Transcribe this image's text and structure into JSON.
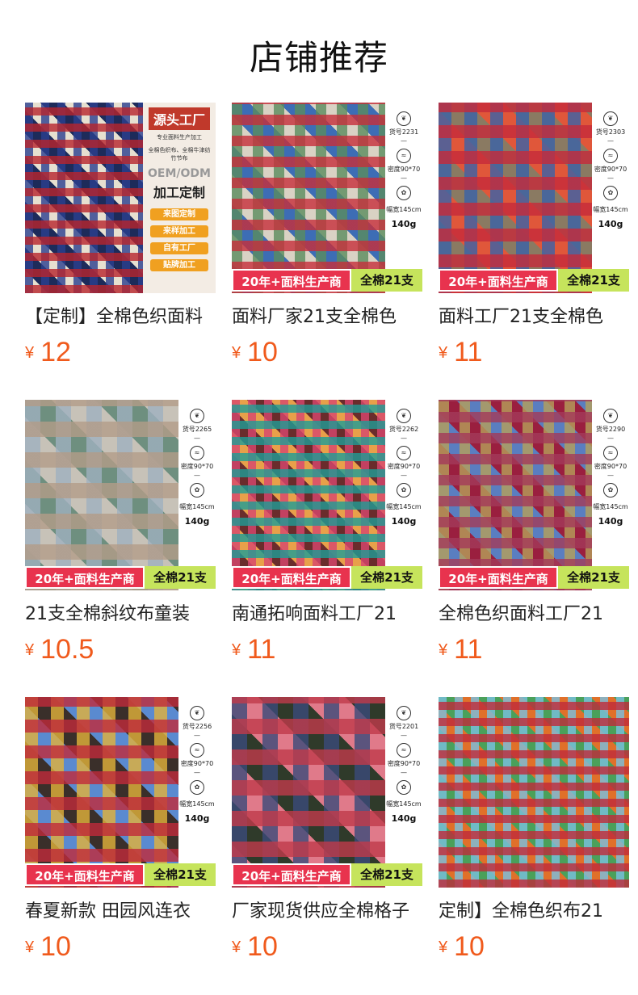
{
  "page": {
    "title": "店铺推荐"
  },
  "promo": {
    "left": "20年+面料生产商",
    "right": "全棉21支"
  },
  "spec_labels": {
    "item_prefix": "货号",
    "density": "密度90*70",
    "width": "幅宽145cm",
    "weight": "140g"
  },
  "hero": {
    "badge": "源头工厂",
    "sub": "专业面料生产加工",
    "desc": "全棉色织布、全棉牛津纺竹节布",
    "oem": "OEM/ODM",
    "proc": "加工定制",
    "pills": [
      "来图定制",
      "来样加工",
      "自有工厂",
      "贴牌加工"
    ]
  },
  "products": [
    {
      "title": "【定制】全棉色织面料",
      "currency": "¥",
      "price": "12",
      "item_no": "",
      "colors": [
        "#b8242c",
        "#2a3f8f",
        "#e6e0d0",
        "#1d2b5a"
      ]
    },
    {
      "title": "面料厂家21支全棉色",
      "currency": "¥",
      "price": "10",
      "item_no": "2231",
      "colors": [
        "#c72e3a",
        "#5a8c5e",
        "#3d6db5",
        "#d9d2c4"
      ]
    },
    {
      "title": "面料工厂21支全棉色",
      "currency": "¥",
      "price": "11",
      "item_no": "2303",
      "colors": [
        "#c62a3a",
        "#3a62a8",
        "#e0573a",
        "#8a7a62"
      ]
    },
    {
      "title": "21支全棉斜纹布童装",
      "currency": "¥",
      "price": "10.5",
      "item_no": "2265",
      "colors": [
        "#b39c88",
        "#9fb0bf",
        "#6e8f7f",
        "#c7c2b8"
      ]
    },
    {
      "title": "南通拓响面料工厂21",
      "currency": "¥",
      "price": "11",
      "item_no": "2262",
      "colors": [
        "#1e9d96",
        "#d8466e",
        "#e8a04a",
        "#6a2c2c"
      ]
    },
    {
      "title": "全棉色织面料工厂21",
      "currency": "¥",
      "price": "11",
      "item_no": "2290",
      "colors": [
        "#a33a5a",
        "#b5a05a",
        "#9a1f3f",
        "#5a7ec0"
      ]
    },
    {
      "title": "春夏新款 田园风连衣",
      "currency": "¥",
      "price": "10",
      "item_no": "2256",
      "colors": [
        "#c02a3a",
        "#e2b23a",
        "#5a8ad0",
        "#3a2f2a"
      ]
    },
    {
      "title": "厂家现货供应全棉格子",
      "currency": "¥",
      "price": "10",
      "item_no": "2201",
      "colors": [
        "#c03a4a",
        "#3a4a7a",
        "#e07a8a",
        "#2f3a2a"
      ]
    },
    {
      "title": "定制】全棉色织布21",
      "currency": "¥",
      "price": "10",
      "item_no": "",
      "colors": [
        "#c02a3a",
        "#7ac0e0",
        "#4aa05a",
        "#e0702a"
      ]
    }
  ]
}
